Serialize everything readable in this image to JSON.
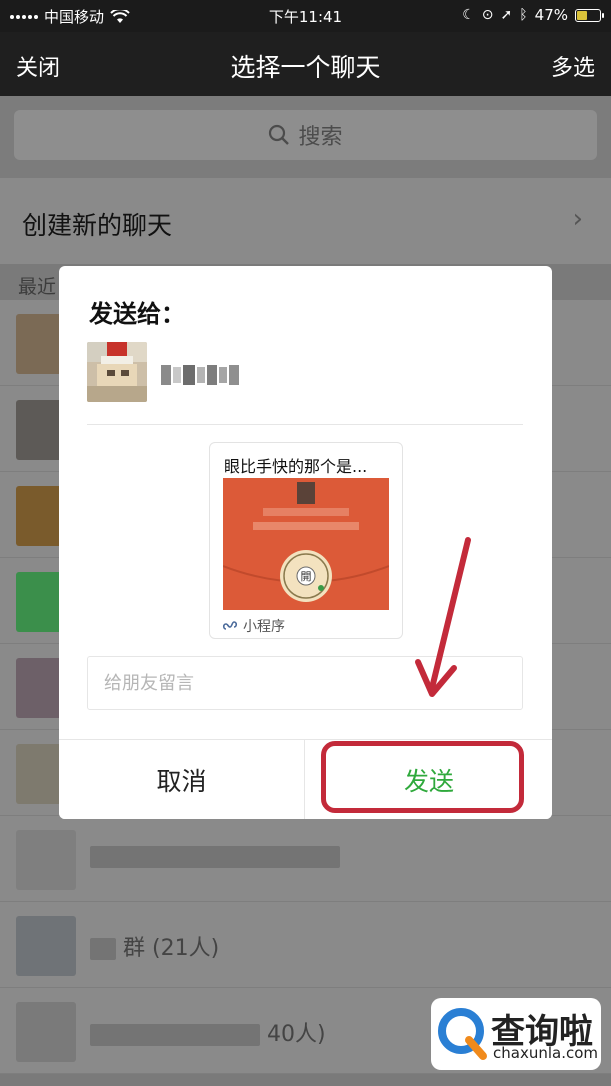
{
  "status_bar": {
    "carrier": "中国移动",
    "time": "下午11:41",
    "battery": "47%",
    "battery_level": 0.47
  },
  "nav": {
    "close_label": "关闭",
    "title": "选择一个聊天",
    "multi_select_label": "多选"
  },
  "search": {
    "label": "搜索"
  },
  "create_chat": {
    "label": "创建新的聊天"
  },
  "recent": {
    "label": "最近"
  },
  "background_chats": [
    {
      "name": "",
      "avatar_color": "#7b6a55"
    },
    {
      "name": "",
      "avatar_color": "#5d5a57"
    },
    {
      "name": "",
      "avatar_color": "#7a5b2c"
    },
    {
      "name": "",
      "avatar_color": "#3b8f4b"
    },
    {
      "name": "",
      "avatar_color": "#6d6068"
    },
    {
      "name": "",
      "avatar_color": "#7e7a6e"
    },
    {
      "name": "",
      "avatar_color": "#7f7f7f"
    },
    {
      "name": "群",
      "suffix": "(21人)",
      "avatar_color": "#6f7377"
    },
    {
      "name": "",
      "suffix": "40人)",
      "avatar_color": "#7a7a7a"
    }
  ],
  "dialog": {
    "send_to_label": "发送给：",
    "mini_program": {
      "title": "眼比手快的那个是...",
      "badge_label": "小程序",
      "seal_char": "開",
      "image_color": "#dc5a38"
    },
    "message_placeholder": "给朋友留言",
    "cancel_label": "取消",
    "send_label": "发送"
  },
  "watermark": {
    "brand": "查询啦",
    "domain": "chaxunla.com"
  },
  "colors": {
    "send_green": "#2fa93c",
    "annotation_red": "#c32a3a",
    "mini_program_red": "#dc5a38"
  }
}
